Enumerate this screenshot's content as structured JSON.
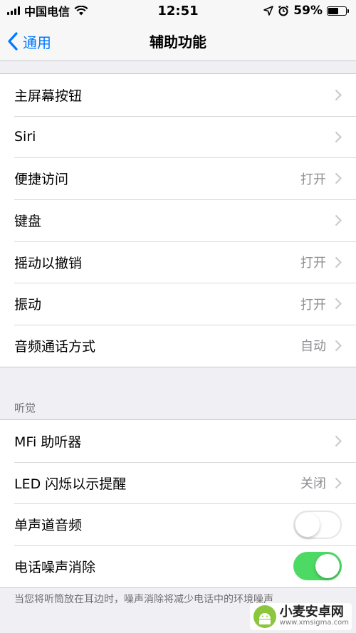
{
  "status_bar": {
    "carrier": "中国电信",
    "time": "12:51",
    "battery_percent": "59%",
    "battery_level": 0.59
  },
  "nav": {
    "back_label": "通用",
    "title": "辅助功能"
  },
  "group1": [
    {
      "label": "主屏幕按钮",
      "value": ""
    },
    {
      "label": "Siri",
      "value": ""
    },
    {
      "label": "便捷访问",
      "value": "打开"
    },
    {
      "label": "键盘",
      "value": ""
    },
    {
      "label": "摇动以撤销",
      "value": "打开"
    },
    {
      "label": "振动",
      "value": "打开"
    },
    {
      "label": "音频通话方式",
      "value": "自动"
    }
  ],
  "hearing_section": {
    "header": "听觉",
    "items": [
      {
        "label": "MFi 助听器",
        "value": ""
      },
      {
        "label": "LED 闪烁以示提醒",
        "value": "关闭"
      },
      {
        "label": "单声道音频",
        "toggle": false
      },
      {
        "label": "电话噪声消除",
        "toggle": true
      }
    ]
  },
  "footer_note": "当您将听筒放在耳边时，噪声消除将减少电话中的环境噪声",
  "watermark": {
    "title": "小麦安卓网",
    "url": "www.xmsigma.com"
  },
  "colors": {
    "accent": "#007aff",
    "toggle_on": "#4cd964",
    "background": "#efeff4",
    "secondary_text": "#8e8e93"
  }
}
